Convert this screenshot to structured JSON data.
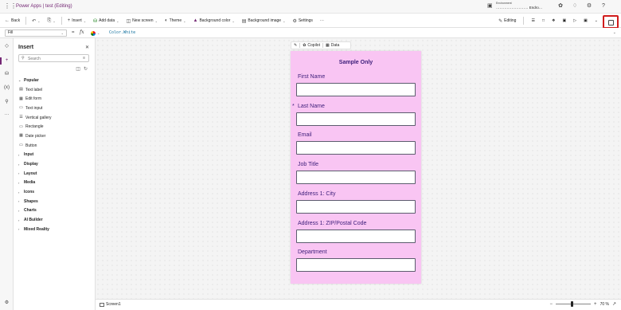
{
  "app": {
    "name": "Power Apps",
    "separator": "|",
    "document": "test (Editing)",
    "environment_label": "Environment",
    "environment_value": "……………………… Endro…"
  },
  "toolbar": {
    "back": "Back",
    "insert": "Insert",
    "add_data": "Add data",
    "new_screen": "New screen",
    "theme": "Theme",
    "background_color": "Background color",
    "background_image": "Background image",
    "settings": "Settings",
    "more": "···",
    "editing": "Editing"
  },
  "formula_bar": {
    "property": "Fill",
    "equals": "=",
    "fx": "fx",
    "formula": "Color.White"
  },
  "insert_pane": {
    "title": "Insert",
    "search_placeholder": "Search",
    "popular_header": "Popular",
    "popular_items": [
      {
        "label": "Text label",
        "icon": "text-label-icon"
      },
      {
        "label": "Edit form",
        "icon": "edit-form-icon"
      },
      {
        "label": "Text input",
        "icon": "text-input-icon"
      },
      {
        "label": "Vertical gallery",
        "icon": "vertical-gallery-icon"
      },
      {
        "label": "Rectangle",
        "icon": "rectangle-icon"
      },
      {
        "label": "Date picker",
        "icon": "date-picker-icon"
      },
      {
        "label": "Button",
        "icon": "button-icon"
      }
    ],
    "categories": [
      "Input",
      "Display",
      "Layout",
      "Media",
      "Icons",
      "Shapes",
      "Charts",
      "AI Builder",
      "Mixed Reality"
    ]
  },
  "canvas_toolbar": {
    "copilot": "Copilot",
    "data": "Data"
  },
  "form": {
    "title": "Sample Only",
    "fields": [
      {
        "label": "First Name",
        "required": false,
        "value": ""
      },
      {
        "label": "Last Name",
        "required": true,
        "value": ""
      },
      {
        "label": "Email",
        "required": false,
        "value": ""
      },
      {
        "label": "Job Title",
        "required": false,
        "value": ""
      },
      {
        "label": "Address 1: City",
        "required": false,
        "value": ""
      },
      {
        "label": "Address 1: ZIP/Postal Code",
        "required": false,
        "value": ""
      },
      {
        "label": "Department",
        "required": false,
        "value": ""
      }
    ],
    "required_mark": "*"
  },
  "statusbar": {
    "screen_name": "Screen1",
    "zoom": "70 %",
    "zoom_fraction": 0.47
  },
  "colors": {
    "brand": "#742774",
    "screen_fill": "#f9c5f3",
    "form_text": "#3c1d79",
    "highlight": "#d01c1c"
  }
}
